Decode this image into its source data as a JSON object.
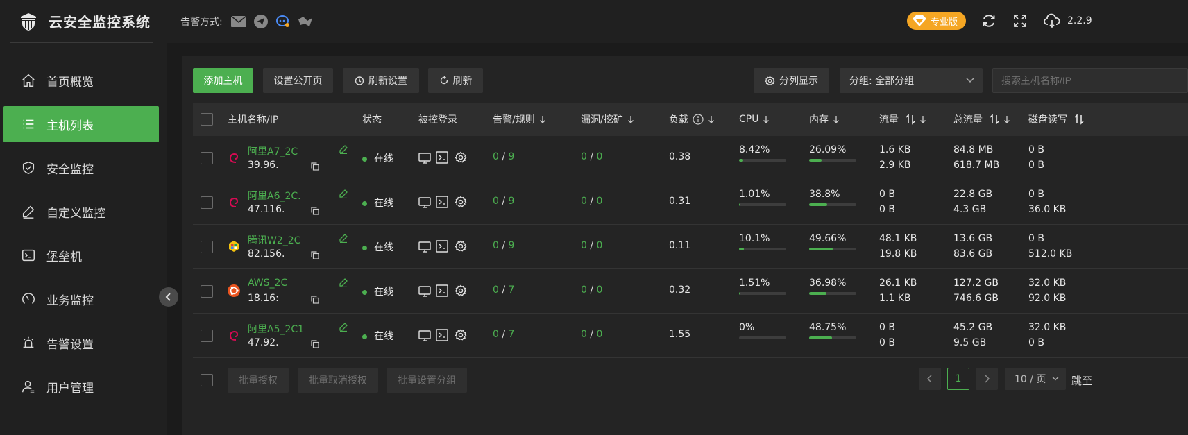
{
  "app": {
    "title": "云安全监控系统",
    "version": "2.2.9",
    "pro_label": "专业版"
  },
  "header": {
    "alert_label": "告警方式:"
  },
  "sidebar": {
    "items": [
      {
        "label": "首页概览",
        "icon": "home-icon"
      },
      {
        "label": "主机列表",
        "icon": "list-icon",
        "active": true
      },
      {
        "label": "安全监控",
        "icon": "shield-icon"
      },
      {
        "label": "自定义监控",
        "icon": "pen-icon"
      },
      {
        "label": "堡垒机",
        "icon": "terminal-icon"
      },
      {
        "label": "业务监控",
        "icon": "gauge-icon"
      },
      {
        "label": "告警设置",
        "icon": "alarm-icon"
      },
      {
        "label": "用户管理",
        "icon": "user-icon"
      }
    ]
  },
  "toolbar": {
    "add_host": "添加主机",
    "public_page": "设置公开页",
    "refresh_settings": "刷新设置",
    "refresh": "刷新",
    "column_display": "分列显示",
    "group_select": "分组: 全部分组",
    "search_placeholder": "搜索主机名称/IP"
  },
  "table": {
    "headers": {
      "host": "主机名称/IP",
      "status": "状态",
      "remote": "被控登录",
      "alerts": "告警/规则",
      "vuln": "漏洞/挖矿",
      "load": "负载",
      "cpu": "CPU",
      "mem": "内存",
      "traffic": "流量",
      "total": "总流量",
      "disk": "磁盘读写"
    },
    "rows": [
      {
        "name": "阿里A7_2C",
        "ip": "39.96.",
        "os": "debian",
        "status": "在线",
        "alert_count": "0",
        "rule_count": "9",
        "vuln": "0",
        "mining": "0",
        "load": "0.38",
        "cpu": "8.42%",
        "cpu_pct": 8.42,
        "mem": "26.09%",
        "mem_pct": 26.09,
        "traffic_up": "1.6 KB",
        "traffic_down": "2.9 KB",
        "total_up": "84.8 MB",
        "total_down": "618.7 MB",
        "disk_read": "0 B",
        "disk_write": "0 B"
      },
      {
        "name": "阿里A6_2C.",
        "ip": "47.116.",
        "os": "debian",
        "status": "在线",
        "alert_count": "0",
        "rule_count": "9",
        "vuln": "0",
        "mining": "0",
        "load": "0.31",
        "cpu": "1.01%",
        "cpu_pct": 1.01,
        "mem": "38.8%",
        "mem_pct": 38.8,
        "traffic_up": "0 B",
        "traffic_down": "0 B",
        "total_up": "22.8 GB",
        "total_down": "4.3 GB",
        "disk_read": "0 B",
        "disk_write": "36.0 KB"
      },
      {
        "name": "腾讯W2_2C",
        "ip": "82.156.",
        "os": "windows",
        "status": "在线",
        "alert_count": "0",
        "rule_count": "9",
        "vuln": "0",
        "mining": "0",
        "load": "0.11",
        "cpu": "10.1%",
        "cpu_pct": 10.1,
        "mem": "49.66%",
        "mem_pct": 49.66,
        "traffic_up": "48.1 KB",
        "traffic_down": "19.8 KB",
        "total_up": "13.6 GB",
        "total_down": "83.6 GB",
        "disk_read": "0 B",
        "disk_write": "512.0 KB"
      },
      {
        "name": "AWS_2C",
        "ip": "18.16:",
        "os": "ubuntu",
        "status": "在线",
        "alert_count": "0",
        "rule_count": "7",
        "vuln": "0",
        "mining": "0",
        "load": "0.32",
        "cpu": "1.51%",
        "cpu_pct": 1.51,
        "mem": "36.98%",
        "mem_pct": 36.98,
        "traffic_up": "26.1 KB",
        "traffic_down": "1.1 KB",
        "total_up": "127.2 GB",
        "total_down": "746.6 GB",
        "disk_read": "32.0 KB",
        "disk_write": "92.0 KB"
      },
      {
        "name": "阿里A5_2C1",
        "ip": "47.92.",
        "os": "debian",
        "status": "在线",
        "alert_count": "0",
        "rule_count": "7",
        "vuln": "0",
        "mining": "0",
        "load": "1.55",
        "cpu": "0%",
        "cpu_pct": 0,
        "mem": "48.75%",
        "mem_pct": 48.75,
        "traffic_up": "0 B",
        "traffic_down": "0 B",
        "total_up": "45.2 GB",
        "total_down": "9.5 GB",
        "disk_read": "32.0 KB",
        "disk_write": "0 B"
      }
    ]
  },
  "footer": {
    "batch_auth": "批量授权",
    "batch_unauth": "批量取消授权",
    "batch_group": "批量设置分组",
    "page": "1",
    "page_size": "10 / 页",
    "jump": "跳至"
  },
  "colors": {
    "accent": "#4caf50",
    "pro": "#f5a623",
    "debian": "#d70a53",
    "ubuntu": "#e95420"
  }
}
